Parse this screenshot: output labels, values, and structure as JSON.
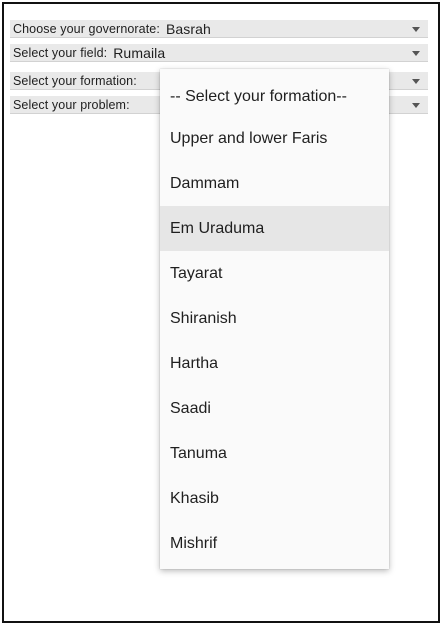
{
  "selectors": {
    "governorate": {
      "label": "Choose your governorate:",
      "value": "Basrah"
    },
    "field": {
      "label": "Select your field:",
      "value": "Rumaila"
    },
    "formation": {
      "label": "Select your formation:"
    },
    "problem": {
      "label": "Select your problem:"
    }
  },
  "formation_dropdown": {
    "options": [
      "-- Select your formation--",
      "Upper and lower Faris",
      "Dammam",
      "Em Uraduma",
      "Tayarat",
      "Shiranish",
      "Hartha",
      "Saadi",
      "Tanuma",
      "Khasib",
      "Mishrif"
    ],
    "highlighted": "Em Uraduma"
  },
  "icons": {
    "dropdown_arrow": "chevron-down-icon"
  },
  "colors": {
    "row_background": "#e9e9e9",
    "menu_background": "#fafafa",
    "highlight": "#e6e6e6",
    "text": "#1f1f1f"
  }
}
